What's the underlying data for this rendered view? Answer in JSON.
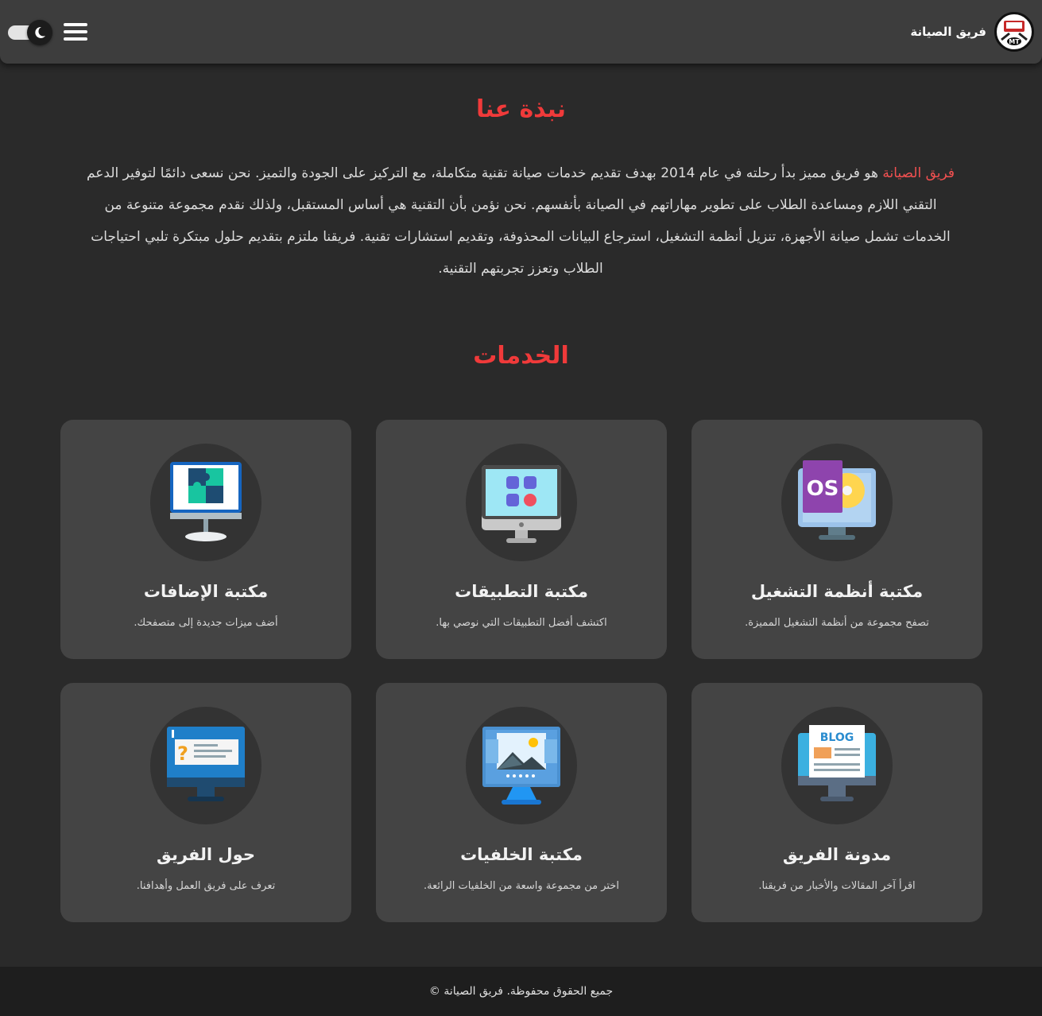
{
  "header": {
    "brand_name": "فريق الصيانة",
    "logo_text": "MT",
    "theme_toggle_state": "dark",
    "menu_icon": "hamburger-icon",
    "mode_icon": "moon-icon"
  },
  "about": {
    "title": "نبذة عنا",
    "highlight": "فريق الصيانة",
    "body": " هو فريق مميز بدأ رحلته في عام 2014 بهدف تقديم خدمات صيانة تقنية متكاملة، مع التركيز على الجودة والتميز. نحن نسعى دائمًا لتوفير الدعم التقني اللازم ومساعدة الطلاب على تطوير مهاراتهم في الصيانة بأنفسهم. نحن نؤمن بأن التقنية هي أساس المستقبل، ولذلك نقدم مجموعة متنوعة من الخدمات تشمل صيانة الأجهزة، تنزيل أنظمة التشغيل، استرجاع البيانات المحذوفة، وتقديم استشارات تقنية. فريقنا ملتزم بتقديم حلول مبتكرة تلبي احتياجات الطلاب وتعزز تجربتهم التقنية."
  },
  "services": {
    "title": "الخدمات",
    "items": [
      {
        "title": "مكتبة أنظمة التشغيل",
        "desc": "تصفح مجموعة من أنظمة التشغيل المميزة.",
        "icon": "os-monitor-icon",
        "icon_text": "OS"
      },
      {
        "title": "مكتبة التطبيقات",
        "desc": "اكتشف أفضل التطبيقات التي نوصي بها.",
        "icon": "apps-monitor-icon"
      },
      {
        "title": "مكتبة الإضافات",
        "desc": "أضف ميزات جديدة إلى متصفحك.",
        "icon": "puzzle-monitor-icon"
      },
      {
        "title": "مدونة الفريق",
        "desc": "اقرأ آخر المقالات والأخبار من فريقنا.",
        "icon": "blog-monitor-icon",
        "icon_text": "BLOG"
      },
      {
        "title": "مكتبة الخلفيات",
        "desc": "اختر من مجموعة واسعة من الخلفيات الرائعة.",
        "icon": "wallpaper-monitor-icon"
      },
      {
        "title": "حول الفريق",
        "desc": "تعرف على فريق العمل وأهدافنا.",
        "icon": "about-monitor-icon",
        "icon_text": "?"
      }
    ]
  },
  "footer": {
    "text": "جميع الحقوق محفوظة. فريق الصيانة ©"
  },
  "colors": {
    "accent": "#f03a3a",
    "background": "#2a2a2a",
    "header": "#3d3d3d",
    "card": "#444444",
    "footer": "#1e1e1e"
  }
}
